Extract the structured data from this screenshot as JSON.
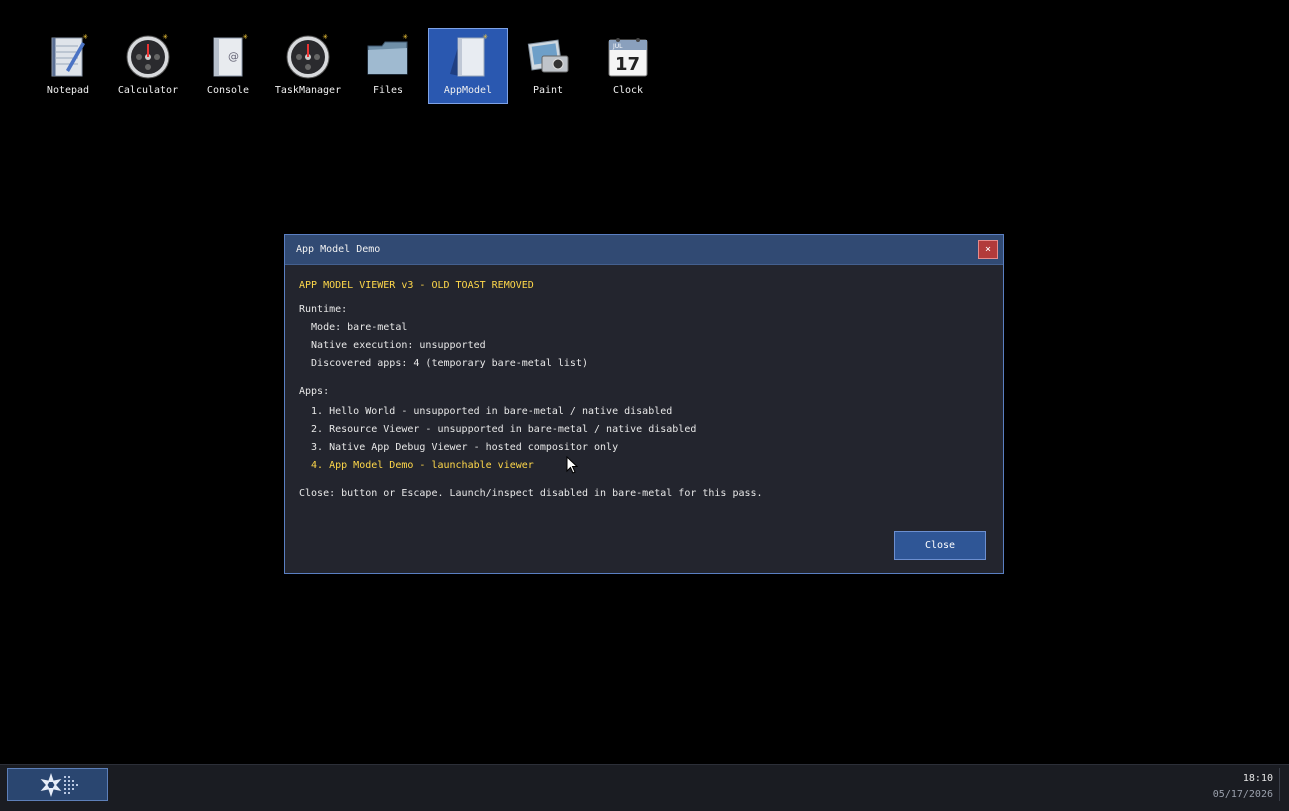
{
  "desktop": {
    "icons": [
      {
        "label": "Notepad",
        "icon": "notepad-icon",
        "selected": false
      },
      {
        "label": "Calculator",
        "icon": "calculator-icon",
        "selected": false
      },
      {
        "label": "Console",
        "icon": "console-icon",
        "selected": false
      },
      {
        "label": "TaskManager",
        "icon": "taskmanager-icon",
        "selected": false
      },
      {
        "label": "Files",
        "icon": "folder-icon",
        "selected": false
      },
      {
        "label": "AppModel",
        "icon": "appmodel-icon",
        "selected": true
      },
      {
        "label": "Paint",
        "icon": "paint-icon",
        "selected": false
      },
      {
        "label": "Clock",
        "icon": "calendar-icon",
        "selected": false
      }
    ],
    "calendar_day": "17",
    "calendar_month": "JUL"
  },
  "dialog": {
    "title": "App Model Demo",
    "close_x": "×",
    "heading": "APP MODEL VIEWER v3 - OLD TOAST REMOVED",
    "runtime_label": "Runtime:",
    "runtime": [
      "  Mode: bare-metal",
      "  Native execution: unsupported",
      "  Discovered apps: 4 (temporary bare-metal list)"
    ],
    "apps_label": "Apps:",
    "apps": [
      "  1. Hello World - unsupported in bare-metal / native disabled",
      "  2. Resource Viewer - unsupported in bare-metal / native disabled",
      "  3. Native App Debug Viewer - hosted compositor only",
      "  4. App Model Demo - launchable viewer"
    ],
    "footer_note": "Close: button or Escape. Launch/inspect disabled in bare-metal for this pass.",
    "close_button": "Close"
  },
  "taskbar": {
    "time": "18:10",
    "date": "05/17/2026"
  },
  "colors": {
    "accent": "#2a58b0",
    "highlight_text": "#ffd84a",
    "close_red": "#b23a3a"
  }
}
